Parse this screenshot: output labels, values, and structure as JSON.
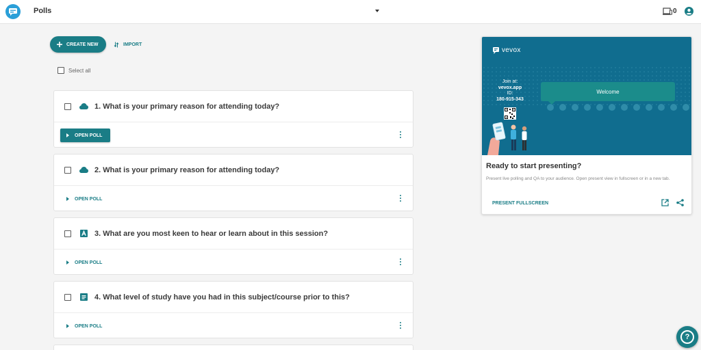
{
  "header": {
    "title": "Polls",
    "device_count": "0",
    "colors": {
      "accent": "#1a7d86",
      "logo": "#2a9fd8"
    }
  },
  "toolbar": {
    "create_label": "CREATE NEW",
    "import_label": "IMPORT"
  },
  "select_all_label": "Select all",
  "polls": [
    {
      "number": "1.",
      "question": "1. What is your primary reason for attending today?",
      "type_icon": "cloud-icon",
      "open_label": "OPEN POLL"
    },
    {
      "number": "2.",
      "question": "2. What is your primary reason for attending today?",
      "type_icon": "cloud-icon",
      "open_label": "OPEN POLL"
    },
    {
      "number": "3.",
      "question": "3. What are you most keen to hear or learn about in this session?",
      "type_icon": "text-icon",
      "open_label": "OPEN POLL"
    },
    {
      "number": "4.",
      "question": "4. What level of study have you had in this subject/course prior to this?",
      "type_icon": "list-icon",
      "open_label": "OPEN POLL"
    }
  ],
  "presenter": {
    "brand": "vevox",
    "join_at_label": "Join at:",
    "join_url": "vevox.app",
    "id_label": "ID:",
    "session_id": "180-915-343",
    "welcome_text": "Welcome",
    "title": "Ready to start presenting?",
    "description": "Present live polling and QA to your audience. Open present view in fullscreen or in a new tab.",
    "present_label": "PRESENT FULLSCREEN",
    "colors": {
      "preview_bg": "#106d8f",
      "bubble": "#1b8c8b"
    }
  },
  "help": {
    "label": "?"
  }
}
